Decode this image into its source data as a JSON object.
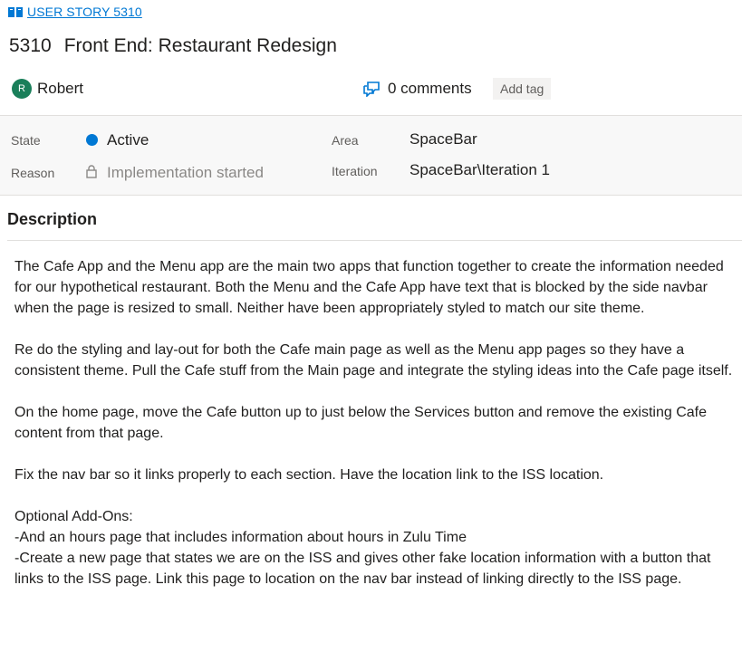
{
  "work_item": {
    "type_label": "USER STORY 5310",
    "id": "5310",
    "title": "Front End: Restaurant Redesign",
    "assignee": {
      "initial": "R",
      "name": "Robert"
    },
    "comments_label": "0 comments",
    "add_tag_label": "Add tag"
  },
  "fields": {
    "state": {
      "label": "State",
      "value": "Active"
    },
    "reason": {
      "label": "Reason",
      "value": "Implementation started"
    },
    "area": {
      "label": "Area",
      "value": "SpaceBar"
    },
    "iteration": {
      "label": "Iteration",
      "value": "SpaceBar\\Iteration 1"
    }
  },
  "description": {
    "heading": "Description",
    "paragraphs": [
      "The Cafe App and the Menu app are the main two apps that function together to create the information needed for our hypothetical restaurant. Both the Menu and the Cafe App have text that is blocked by the side navbar when the page is resized to small. Neither have been appropriately styled to match our site theme.",
      "Re do the styling and lay-out for both the Cafe main page as well as the Menu app pages so they have a consistent theme. Pull the Cafe stuff from the Main page and integrate the styling ideas into the Cafe page itself.",
      "On the home page, move the Cafe button up to just below the Services button and remove the existing Cafe content from that page.",
      "Fix the nav bar so it links properly to each section. Have the location link to the ISS location."
    ],
    "addons_heading": "Optional Add-Ons:",
    "addons": [
      "-And an hours page that includes information about hours in Zulu Time",
      "-Create a new page that states we are on the ISS and gives other fake location information with a button that links to the ISS page. Link this page to location on the nav bar instead of linking directly to the ISS page."
    ]
  },
  "colors": {
    "accent": "#0078d4",
    "avatar": "#1a7f5a",
    "state_active": "#0078d4"
  },
  "icons": {
    "type": "book-icon",
    "comments": "comments-icon",
    "reason": "lock-icon"
  }
}
